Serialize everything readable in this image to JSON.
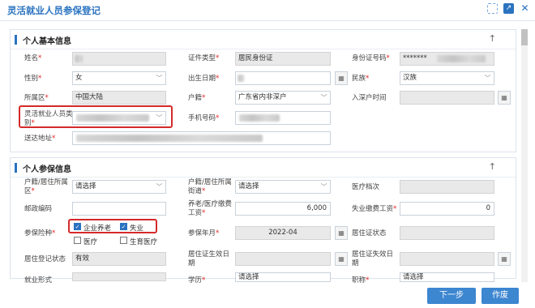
{
  "dialog": {
    "title": "灵活就业人员参保登记"
  },
  "personal": {
    "section_title": "个人基本信息",
    "name_label": "姓名",
    "cert_type_label": "证件类型",
    "cert_type_value": "居民身份证",
    "id_label": "身份证号码",
    "id_value": "*******",
    "gender_label": "性别",
    "gender_value": "女",
    "birth_label": "出生日期",
    "ethnic_label": "民族",
    "ethnic_value": "汉族",
    "region_label": "所属区",
    "region_value": "中国大陆",
    "hukou_label": "户籍",
    "hukou_value": "广东省内非深户",
    "entry_time_label": "入深户时间",
    "flex_type_label": "灵活就业人员类别",
    "phone_label": "手机号码",
    "address_label": "送达地址"
  },
  "insurance": {
    "section_title": "个人参保信息",
    "hukou_district_label": "户籍/居住所属区",
    "hukou_district_value": "请选择",
    "hukou_street_label": "户籍/居住所属街道",
    "hukou_street_value": "请选择",
    "medical_level_label": "医疗档次",
    "postcode_label": "邮政编码",
    "pension_base_label": "养老/医疗缴费工资",
    "pension_base_value": "6,000",
    "unemp_base_label": "失业缴费工资",
    "unemp_base_value": "0",
    "types_label": "参保险种",
    "type_pension": "企业养老",
    "type_unemp": "失业",
    "type_medical": "医疗",
    "type_maternity": "生育医疗",
    "year_month_label": "参保年月",
    "year_month_value": "2022-04",
    "residence_status_label": "居住证状态",
    "reg_status_label": "居住登记状态",
    "reg_status_value": "有效",
    "residence_start_label": "居住证生效日期",
    "residence_end_label": "居住证失效日期",
    "employment_label": "就业形式",
    "education_label": "学历",
    "education_value": "请选择",
    "title_label": "职称",
    "title_value": "请选择"
  },
  "buttons": {
    "next": "下一步",
    "cancel": "作废"
  }
}
